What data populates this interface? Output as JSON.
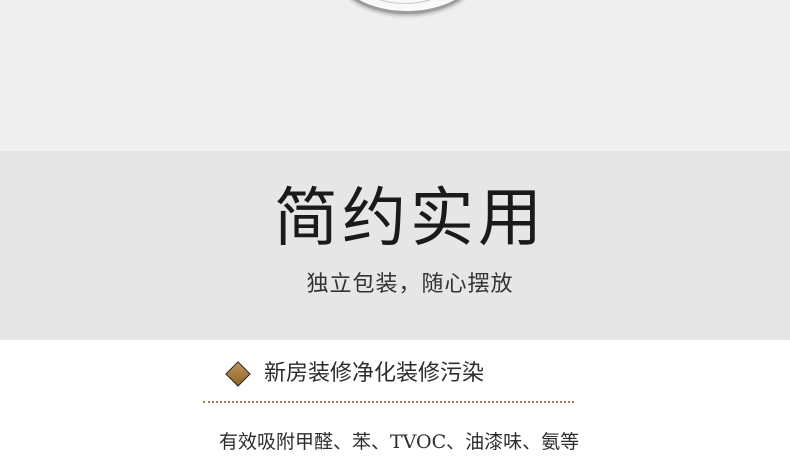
{
  "banner": {
    "title": "简约实用",
    "subtitle": "独立包装，随心摆放"
  },
  "feature": {
    "icon": "diamond-icon",
    "heading": "新房装修净化装修污染",
    "text": "有效吸附甲醛、苯、TVOC、油漆味、氨等"
  },
  "colors": {
    "top_background": "#efefef",
    "banner_background": "#e6e6e6",
    "accent_gold": "#a67c3f"
  }
}
